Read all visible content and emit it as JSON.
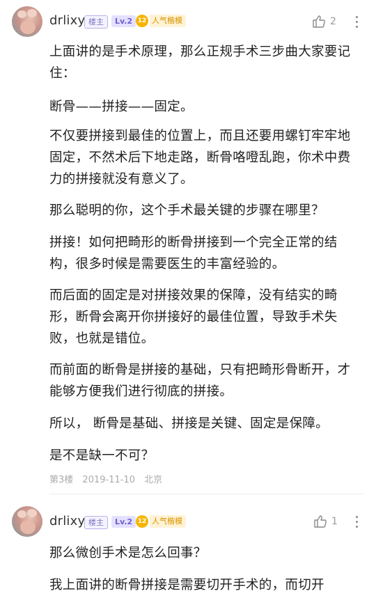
{
  "posts": [
    {
      "username": "drlixy",
      "owner_badge": "楼主",
      "level": "Lv.2",
      "pop_badge_num": "12",
      "pop_badge_label": "人气楷模",
      "like_count": "2",
      "paragraphs": [
        "上面讲的是手术原理，那么正规手术三步曲大家要记住：",
        "断骨——拼接——固定。",
        "不仅要拼接到最佳的位置上，而且还要用螺钉牢牢地固定，不然术后下地走路，断骨咯噔乱跑，你术中费力的拼接就没有意义了。",
        "那么聪明的你，这个手术最关键的步骤在哪里？",
        "拼接！如何把畸形的断骨拼接到一个完全正常的结构，很多时候是需要医生的丰富经验的。",
        "而后面的固定是对拼接效果的保障，没有结实的畸形，断骨会离开你拼接好的最佳位置，导致手术失败，也就是错位。",
        "而前面的断骨是拼接的基础，只有把畸形骨断开，才能够方便我们进行彻底的拼接。",
        "所以， 断骨是基础、拼接是关键、固定是保障。",
        "是不是缺一不可？"
      ],
      "floor": "第3楼",
      "date": "2019-11-10",
      "location": "北京"
    },
    {
      "username": "drlixy",
      "owner_badge": "楼主",
      "level": "Lv.2",
      "pop_badge_num": "12",
      "pop_badge_label": "人气楷模",
      "like_count": "1",
      "paragraphs": [
        "那么微创手术是怎么回事？",
        "我上面讲的断骨拼接是需要切开手术的，而切开"
      ]
    }
  ],
  "colors": {
    "text": "#222222",
    "meta": "#aaaaaa",
    "owner_badge": "#7b74c6",
    "level_badge": "#6a5fd0",
    "pop_badge": "#f7b500"
  },
  "icons": {
    "like": "thumbs-up-icon",
    "more": "more-vertical-icon"
  }
}
